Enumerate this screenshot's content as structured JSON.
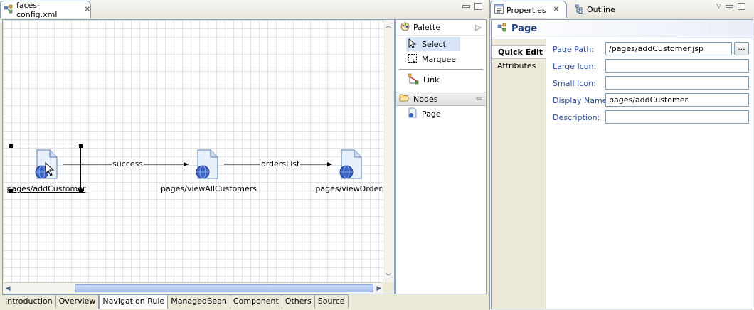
{
  "editor": {
    "tab_title": "faces-config.xml",
    "nodes": [
      {
        "label": "pages/addCustomer"
      },
      {
        "label": "pages/viewAllCustomers"
      },
      {
        "label": "pages/viewOrders"
      }
    ],
    "edges": [
      {
        "label": "success"
      },
      {
        "label": "ordersList"
      }
    ],
    "palette": {
      "title": "Palette",
      "tools": [
        {
          "label": "Select",
          "icon": "arrow-pointer-icon"
        },
        {
          "label": "Marquee",
          "icon": "marquee-icon"
        },
        {
          "label": "Link",
          "icon": "link-icon"
        }
      ],
      "drawer_title": "Nodes",
      "drawer_items": [
        {
          "label": "Page",
          "icon": "page-icon"
        }
      ]
    },
    "bottom_tabs": [
      "Introduction",
      "Overview",
      "Navigation Rule",
      "ManagedBean",
      "Component",
      "Others",
      "Source"
    ],
    "active_bottom_tab": "Navigation Rule"
  },
  "properties": {
    "tab_label": "Properties",
    "outline_label": "Outline",
    "title": "Page",
    "side_tabs": [
      "Quick Edit",
      "Attributes"
    ],
    "fields": [
      {
        "label": "Page Path:",
        "value": "/pages/addCustomer.jsp"
      },
      {
        "label": "Large Icon:",
        "value": ""
      },
      {
        "label": "Small Icon:",
        "value": ""
      },
      {
        "label": "Display Name:",
        "value": "pages/addCustomer"
      },
      {
        "label": "Description:",
        "value": ""
      }
    ],
    "browse_label": "..."
  },
  "colors": {
    "title_blue": "#24407a",
    "label_blue": "#2b4ea0",
    "selection": "#d8e4f8"
  }
}
